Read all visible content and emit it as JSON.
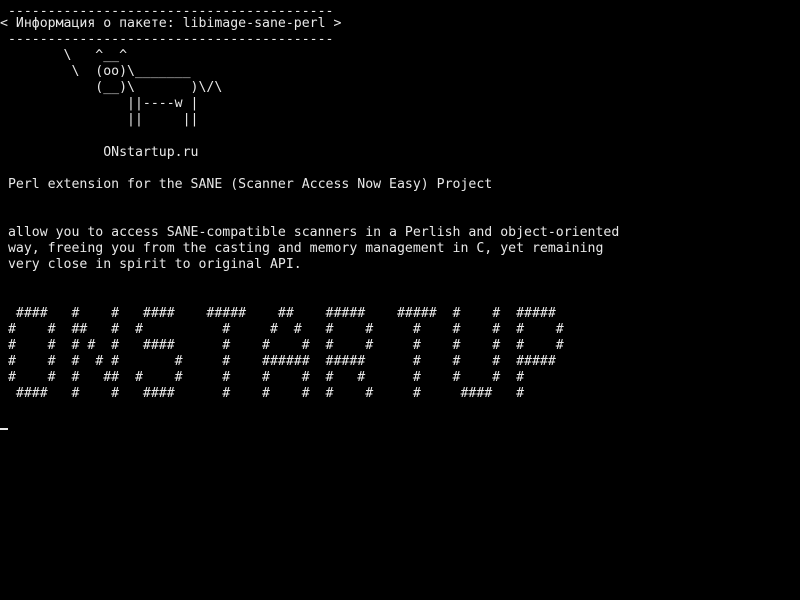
{
  "terminal": {
    "header": {
      "rule_top": " -----------------------------------------",
      "title": "< Информация о пакете: libimage-sane-perl >",
      "rule_bottom": " -----------------------------------------"
    },
    "cow": [
      "        \\   ^__^",
      "         \\  (oo)\\_______",
      "            (__)\\       )\\/\\",
      "                ||----w |",
      "                ||     ||"
    ],
    "site": "             ONstartup.ru",
    "summary": " Perl extension for the SANE (Scanner Access Now Easy) Project",
    "description": [
      " allow you to access SANE-compatible scanners in a Perlish and object-oriented",
      " way, freeing you from the casting and memory management in C, yet remaining",
      " very close in spirit to original API."
    ],
    "banner": [
      "  ####   #    #   ####    #####    ##    #####    #####  #    #  #####",
      " #    #  ##   #  #          #     #  #   #    #     #    #    #  #    #",
      " #    #  # #  #   ####      #    #    #  #    #     #    #    #  #    #",
      " #    #  #  # #       #     #    ######  #####      #    #    #  #####",
      " #    #  #   ##  #    #     #    #    #  #   #      #    #    #  #",
      "  ####   #    #   ####      #    #    #  #    #     #     ####   #"
    ]
  }
}
